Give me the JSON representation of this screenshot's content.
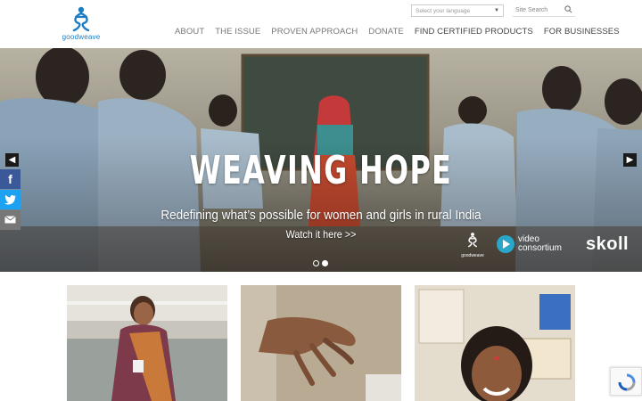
{
  "brand": {
    "logo_text": "goodweave",
    "accent": "#1c7dc4"
  },
  "header": {
    "language_placeholder": "Select your language",
    "search_placeholder": "Site Search",
    "nav": [
      "ABOUT",
      "THE ISSUE",
      "PROVEN APPROACH",
      "DONATE",
      "FIND CERTIFIED PRODUCTS",
      "FOR BUSINESSES"
    ]
  },
  "hero": {
    "title": "WEAVING HOPE",
    "subtitle": "Redefining what’s possible for women and girls in rural India",
    "link": "Watch it here >>",
    "slides_total": 2,
    "slide_active": 2,
    "partners": {
      "goodweave": "goodweave",
      "video_consortium": "video consortium",
      "skoll": "skoll"
    }
  },
  "social": [
    "facebook-icon",
    "twitter-icon",
    "mail-icon"
  ],
  "cards": [
    "woman-worker-photo",
    "hand-on-rug-photo",
    "smiling-child-photo"
  ]
}
